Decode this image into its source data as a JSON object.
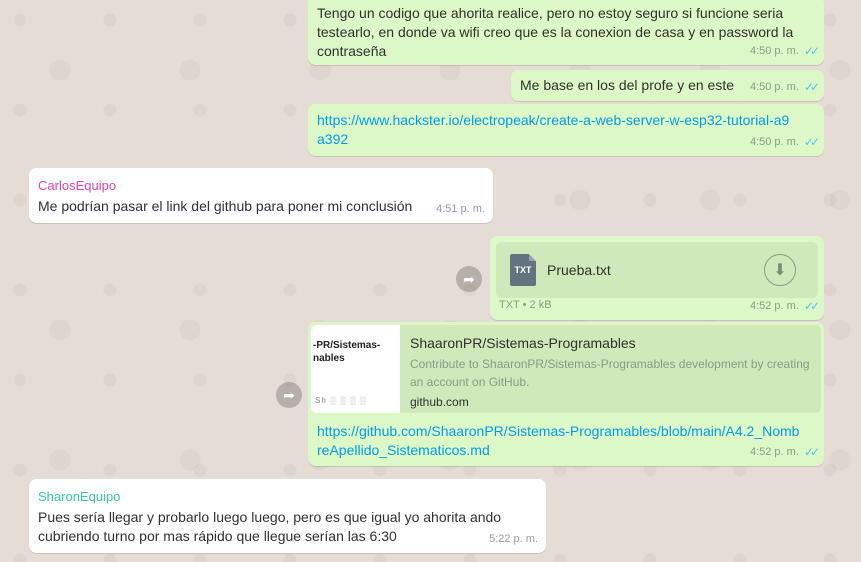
{
  "messages": {
    "m1": {
      "text": "Tengo un codigo que ahorita realice, pero no estoy seguro si funcione seria testearlo, en donde va wifi creo que es la conexion de casa y en password la contraseña",
      "time": "4:50 p. m."
    },
    "m2": {
      "text": "Me base en los del profe y en este",
      "time": "4:50 p. m."
    },
    "m3": {
      "text": "https://www.hackster.io/electropeak/create-a-web-server-w-esp32-tutorial-a9a392",
      "time": "4:50 p. m."
    },
    "m4": {
      "sender": "CarlosEquipo",
      "text": "Me podrían pasar el link del github para poner mi conclusión",
      "time": "4:51 p. m."
    },
    "m5": {
      "file_type": "TXT",
      "file_name": "Prueba.txt",
      "file_info": "TXT • 2 kB",
      "time": "4:52 p. m."
    },
    "m6": {
      "preview_thumb_line1": "-PR/Sistemas-",
      "preview_thumb_line2": "nables",
      "preview_thumb_foot": "Sh ░ ░ ░ ░",
      "preview_title": "ShaaronPR/Sistemas-Programables",
      "preview_desc": "Contribute to ShaaronPR/Sistemas-Programables development by creating an account on GitHub.",
      "preview_domain": "github.com",
      "text": "https://github.com/ShaaronPR/Sistemas-Programables/blob/main/A4.2_NombreApellido_Sistematicos.md",
      "time": "4:52 p. m."
    },
    "m7": {
      "sender": "SharonEquipo",
      "text": "Pues sería llegar y probarlo luego luego, pero es que igual yo ahorita ando cubriendo turno por mas rápido que llegue serían las 6:30",
      "time": "5:22 p. m."
    }
  },
  "icons": {
    "read_ticks": "double-check-icon",
    "forward": "forward-icon",
    "download": "download-icon"
  },
  "colors": {
    "outgoing": "#dcf8c6",
    "incoming": "#ffffff",
    "link": "#039be5",
    "carlos": "#e542a3",
    "sharon": "#35cd96",
    "ticks": "#4fc3f7"
  }
}
